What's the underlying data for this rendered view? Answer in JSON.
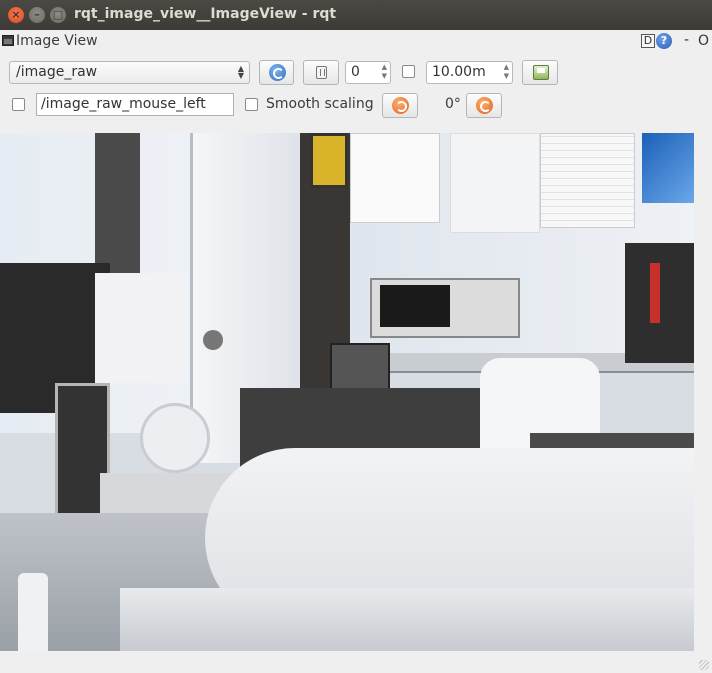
{
  "window": {
    "title": "rqt_image_view__ImageView - rqt"
  },
  "dock": {
    "title": "Image View",
    "d_label": "D",
    "help_label": "?",
    "min_label": "-",
    "close_label": "O"
  },
  "toolbar": {
    "topic": "/image_raw",
    "zoom_value": "0",
    "time_value": "10.00m",
    "mouse_topic": "/image_raw_mouse_left",
    "smooth_scaling_label": "Smooth scaling",
    "rotation_label": "0°"
  },
  "icons": {
    "refresh": "refresh-icon",
    "pause": "pause-icon",
    "save": "save-image-icon",
    "rotate_left": "rotate-left-icon",
    "rotate_right": "rotate-right-icon"
  },
  "image": {
    "description_visible": "camera frame"
  }
}
